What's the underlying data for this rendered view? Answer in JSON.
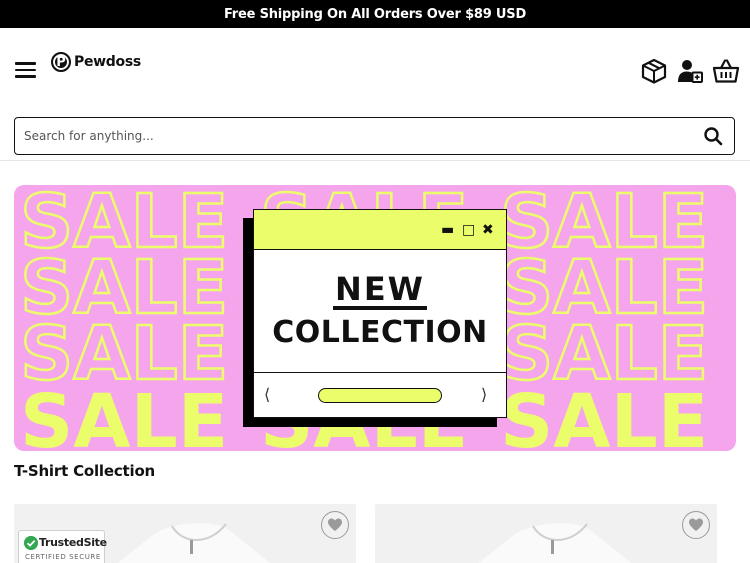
{
  "announcement": {
    "text": "Free Shipping On All Orders Over $89 USD"
  },
  "header": {
    "logo_letter": "P",
    "logo_text": "Pewdoss",
    "icons": [
      "menu-icon",
      "package-icon",
      "account-icon",
      "basket-icon"
    ]
  },
  "search": {
    "placeholder": "Search for anything...",
    "value": ""
  },
  "banner": {
    "background_text": "SALE",
    "popup_title_1": "NEW",
    "popup_title_2": "COLLECTION",
    "colors": {
      "pink": "#f5a5ec",
      "yellow": "#ecfd6b"
    }
  },
  "collection": {
    "title": "T-Shirt Collection"
  },
  "trust_badge": {
    "name": "TrustedSite",
    "subtitle": "CERTIFIED SECURE"
  }
}
